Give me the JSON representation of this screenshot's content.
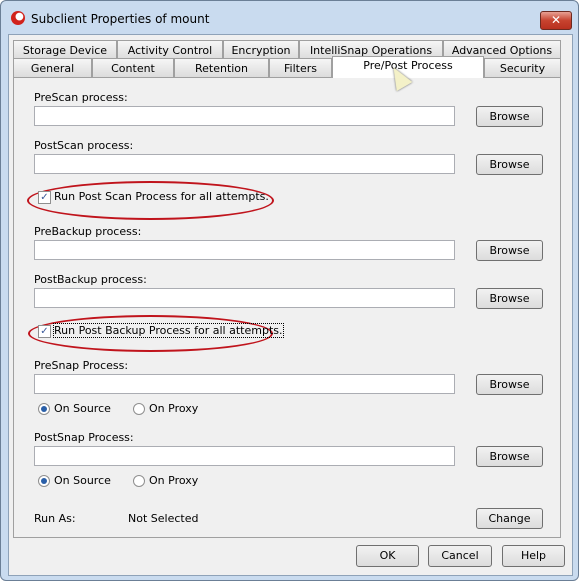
{
  "window": {
    "title": "Subclient Properties of mount",
    "close": "✕"
  },
  "tabs_row1": [
    "Storage Device",
    "Activity Control",
    "Encryption",
    "IntelliSnap Operations",
    "Advanced Options"
  ],
  "tabs_row2": [
    "General",
    "Content",
    "Retention",
    "Filters",
    "Pre/Post Process",
    "Security"
  ],
  "active_tab": "Pre/Post Process",
  "fields": {
    "prescan": {
      "label": "PreScan process:",
      "value": ""
    },
    "postscan": {
      "label": "PostScan process:",
      "value": ""
    },
    "prebackup": {
      "label": "PreBackup process:",
      "value": ""
    },
    "postbackup": {
      "label": "PostBackup process:",
      "value": ""
    },
    "presnap": {
      "label": "PreSnap Process:",
      "value": ""
    },
    "postsnap": {
      "label": "PostSnap Process:",
      "value": ""
    }
  },
  "browse": "Browse",
  "checks": {
    "postscan_all": {
      "label": "Run Post Scan Process for all attempts.",
      "checked": true
    },
    "postbackup_all": {
      "label": "Run Post Backup Process for all attempts.",
      "checked": true
    }
  },
  "radios": {
    "on_source": "On Source",
    "on_proxy": "On Proxy",
    "presnap_selected": "On Source",
    "postsnap_selected": "On Source"
  },
  "run_as": {
    "label": "Run As:",
    "value": "Not Selected",
    "change": "Change"
  },
  "footer": {
    "ok": "OK",
    "cancel": "Cancel",
    "help": "Help"
  },
  "annotation_color": "#c0141c"
}
